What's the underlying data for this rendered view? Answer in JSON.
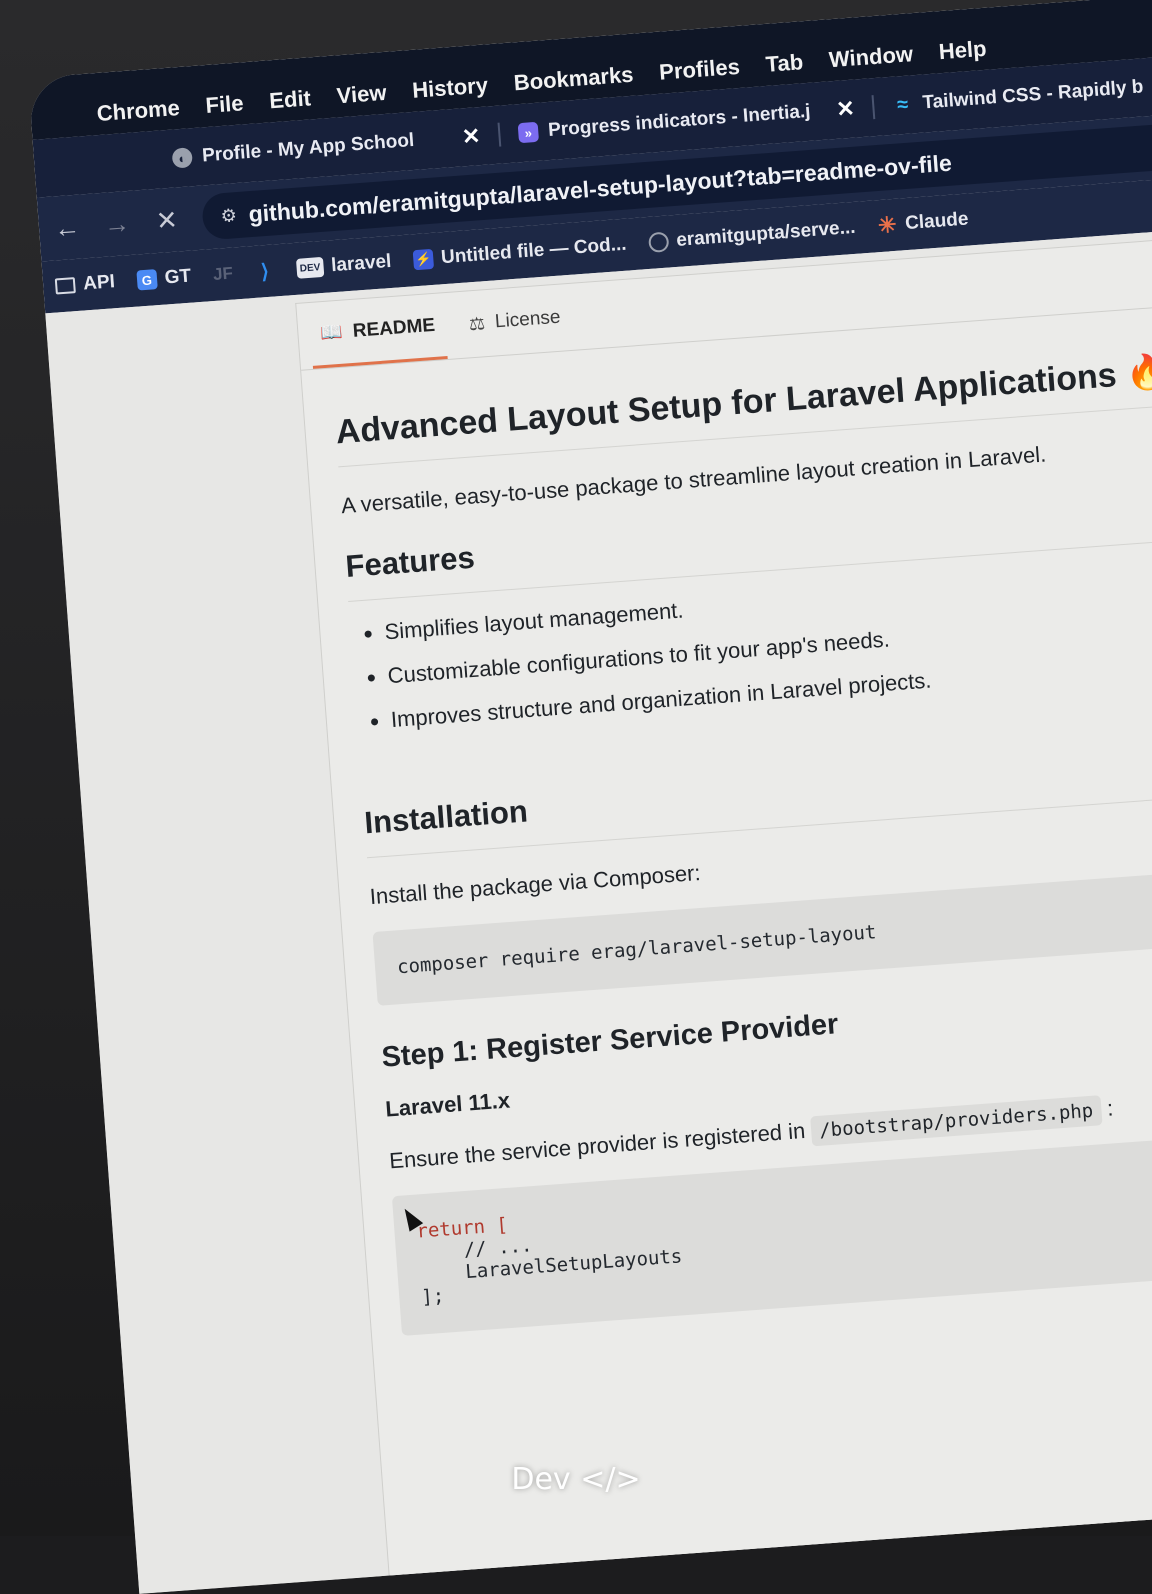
{
  "menubar": {
    "items": [
      "Chrome",
      "File",
      "Edit",
      "View",
      "History",
      "Bookmarks",
      "Profiles",
      "Tab",
      "Window",
      "Help"
    ]
  },
  "tabs": [
    {
      "title": "Profile - My App School",
      "favicon": "globe-icon"
    },
    {
      "title": "Progress indicators - Inertia.j",
      "favicon": "inertia-icon"
    },
    {
      "title": "Tailwind CSS - Rapidly b",
      "favicon": "tailwind-icon"
    }
  ],
  "toolbar": {
    "url": "github.com/eramitgupta/laravel-setup-layout?tab=readme-ov-file"
  },
  "bookmarks": [
    {
      "label": "API",
      "icon": "folder-icon"
    },
    {
      "label": "GT",
      "icon": "google-translate-icon"
    },
    {
      "label": "",
      "icon": "jf-icon"
    },
    {
      "label": "",
      "icon": "vscode-icon"
    },
    {
      "label": "laravel",
      "icon": "dev-icon"
    },
    {
      "label": "Untitled file — Cod...",
      "icon": "lightning-icon"
    },
    {
      "label": "eramitgupta/serve...",
      "icon": "github-icon"
    },
    {
      "label": "Claude",
      "icon": "claude-icon"
    }
  ],
  "readme_tabs": [
    "README",
    "License"
  ],
  "readme": {
    "title": "Advanced Layout Setup for Laravel Applications",
    "emoji": "🔥",
    "intro": "A versatile, easy-to-use package to streamline layout creation in Laravel.",
    "features_heading": "Features",
    "features": [
      "Simplifies layout management.",
      "Customizable configurations to fit your app's needs.",
      "Improves structure and organization in Laravel projects."
    ],
    "installation_heading": "Installation",
    "install_text": "Install the package via Composer:",
    "install_cmd": "composer require erag/laravel-setup-layout",
    "step1_heading": "Step 1: Register Service Provider",
    "laravel_version": "Laravel 11.x",
    "step1_text": "Ensure the service provider is registered in",
    "step1_path": "/bootstrap/providers.php",
    "step1_colon": ":",
    "code_return": "return [",
    "code_comment": "// ...",
    "code_provider": "LaravelSetupLayouts",
    "code_end": "];"
  },
  "watermark": "Dev </>"
}
